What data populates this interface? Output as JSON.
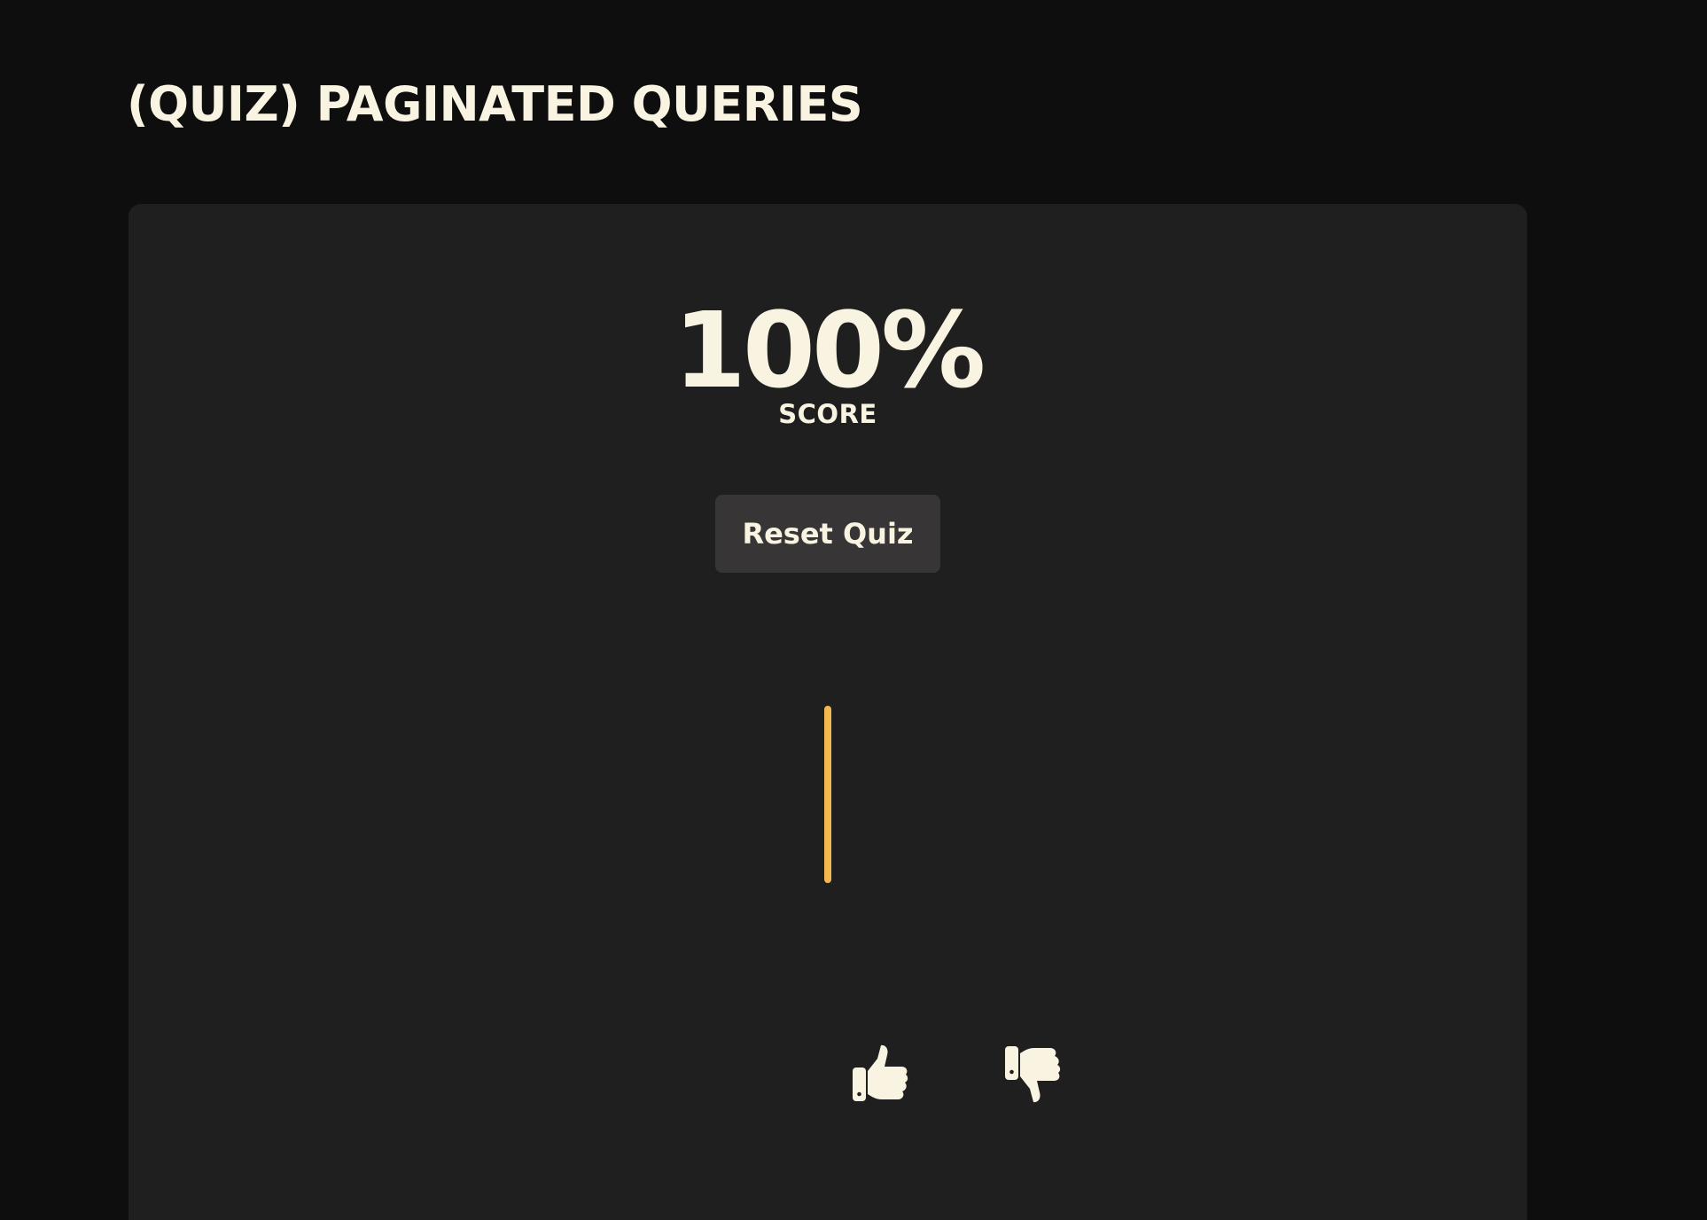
{
  "page": {
    "title": "(QUIZ) PAGINATED QUERIES"
  },
  "score": {
    "value": "100%",
    "label": "SCORE"
  },
  "actions": {
    "reset_label": "Reset Quiz"
  },
  "progress": {
    "fraction": 1.0,
    "color": "#f2b84d"
  },
  "feedback": {
    "thumbs_up_icon": "thumbs-up-icon",
    "thumbs_down_icon": "thumbs-down-icon"
  },
  "colors": {
    "background": "#0f0e0f",
    "panel": "#201f20",
    "button": "#383536",
    "text": "#f8f4e1",
    "accent": "#f2b84d"
  }
}
